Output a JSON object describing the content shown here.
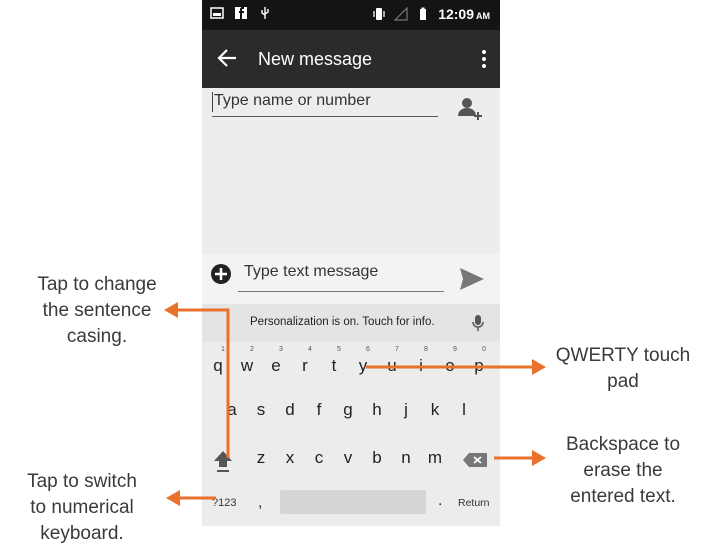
{
  "status_bar": {
    "time": "12:09",
    "ampm": "AM"
  },
  "app_bar": {
    "title": "New message"
  },
  "recipient": {
    "placeholder": "Type name or number"
  },
  "compose": {
    "placeholder": "Type text message"
  },
  "keyboard": {
    "suggestion_text": "Personalization is on. Touch for info.",
    "row1": [
      {
        "key": "q",
        "num": "1"
      },
      {
        "key": "w",
        "num": "2"
      },
      {
        "key": "e",
        "num": "3"
      },
      {
        "key": "r",
        "num": "4"
      },
      {
        "key": "t",
        "num": "5"
      },
      {
        "key": "y",
        "num": "6"
      },
      {
        "key": "u",
        "num": "7"
      },
      {
        "key": "i",
        "num": "8"
      },
      {
        "key": "o",
        "num": "9"
      },
      {
        "key": "p",
        "num": "0"
      }
    ],
    "row2": [
      "a",
      "s",
      "d",
      "f",
      "g",
      "h",
      "j",
      "k",
      "l"
    ],
    "row3": [
      "z",
      "x",
      "c",
      "v",
      "b",
      "n",
      "m"
    ],
    "symbols_label": "?123",
    "comma": ",",
    "period": ".",
    "return_label": "Return"
  },
  "callouts": {
    "sentence_casing": [
      "Tap to change",
      "the sentence",
      "casing."
    ],
    "numerical": [
      "Tap to switch",
      "to numerical",
      "keyboard."
    ],
    "qwerty": [
      "QWERTY touch",
      "pad"
    ],
    "backspace": [
      "Backspace to",
      "erase the",
      "entered text."
    ]
  },
  "colors": {
    "arrow": "#e9712b",
    "status_bar": "#141414",
    "app_bar": "#2b2b2b",
    "content": "#ededed"
  }
}
